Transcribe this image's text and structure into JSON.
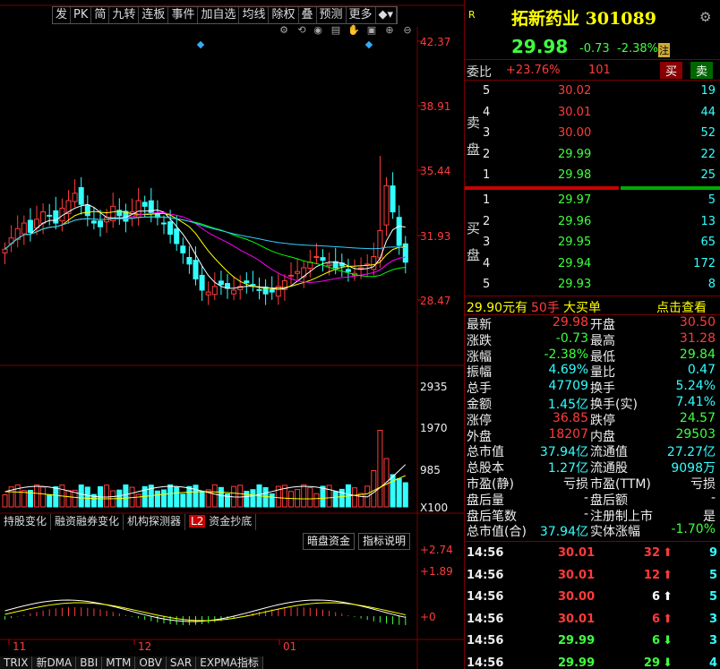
{
  "toolbar": {
    "buttons": [
      "发",
      "PK",
      "简",
      "九转",
      "连板",
      "事件",
      "加自选",
      "均线",
      "除权",
      "叠",
      "预测",
      "更多"
    ]
  },
  "price_axis": [
    "42.37",
    "38.91",
    "35.44",
    "31.93",
    "28.47"
  ],
  "volume_axis": [
    "2935",
    "1970",
    "985",
    "X100"
  ],
  "indicator_axis": [
    "+2.74",
    "+1.89",
    "+0"
  ],
  "date_axis": [
    "11",
    "12",
    "01"
  ],
  "mid_tabs": [
    "持股变化",
    "融资融券变化",
    "机构探测器",
    "资金抄底"
  ],
  "mid_tab_badge": "L2",
  "mid_buttons": [
    "暗盘资金",
    "指标说明"
  ],
  "bottom_tabs": [
    "TRIX",
    "新DMA",
    "BBI",
    "MTM",
    "OBV",
    "SAR",
    "EXPMA指标"
  ],
  "stock": {
    "r_badge": "R",
    "name": "拓新药业",
    "code": "301089",
    "price": "29.98",
    "change": "-0.73",
    "change_pct": "-2.38%",
    "tag": "注"
  },
  "webi": {
    "label": "委比",
    "value": "+23.76%",
    "diff": "101",
    "buy": "买",
    "sell": "卖"
  },
  "sell_label": [
    "卖",
    "盘"
  ],
  "buy_label": [
    "买",
    "盘"
  ],
  "sell_orders": [
    {
      "n": "5",
      "price": "30.02",
      "vol": "19"
    },
    {
      "n": "4",
      "price": "30.01",
      "vol": "44"
    },
    {
      "n": "3",
      "price": "30.00",
      "vol": "52"
    },
    {
      "n": "2",
      "price": "29.99",
      "vol": "22"
    },
    {
      "n": "1",
      "price": "29.98",
      "vol": "25"
    }
  ],
  "buy_orders": [
    {
      "n": "1",
      "price": "29.97",
      "vol": "5"
    },
    {
      "n": "2",
      "price": "29.96",
      "vol": "13"
    },
    {
      "n": "3",
      "price": "29.95",
      "vol": "65"
    },
    {
      "n": "4",
      "price": "29.94",
      "vol": "172"
    },
    {
      "n": "5",
      "price": "29.93",
      "vol": "8"
    }
  ],
  "big_order": {
    "price": "29.90元有",
    "count": "50手",
    "label": "大买单",
    "link": "点击查看"
  },
  "stats": [
    {
      "l1": "最新",
      "v1": "29.98",
      "c1": "red",
      "l2": "开盘",
      "v2": "30.50",
      "c2": "red"
    },
    {
      "l1": "涨跌",
      "v1": "-0.73",
      "c1": "grn",
      "l2": "最高",
      "v2": "31.28",
      "c2": "red"
    },
    {
      "l1": "涨幅",
      "v1": "-2.38%",
      "c1": "grn",
      "l2": "最低",
      "v2": "29.84",
      "c2": "grn"
    },
    {
      "l1": "振幅",
      "v1": "4.69%",
      "c1": "cyan",
      "l2": "量比",
      "v2": "0.47",
      "c2": "cyan"
    },
    {
      "l1": "总手",
      "v1": "47709",
      "c1": "cyan",
      "l2": "换手",
      "v2": "5.24%",
      "c2": "cyan"
    },
    {
      "l1": "金额",
      "v1": "1.45亿",
      "c1": "cyan",
      "l2": "换手(实)",
      "v2": "7.41%",
      "c2": "cyan"
    },
    {
      "l1": "涨停",
      "v1": "36.85",
      "c1": "red",
      "l2": "跌停",
      "v2": "24.57",
      "c2": "grn"
    },
    {
      "l1": "外盘",
      "v1": "18207",
      "c1": "red",
      "l2": "内盘",
      "v2": "29503",
      "c2": "grn"
    },
    {
      "l1": "总市值",
      "v1": "37.94亿",
      "c1": "cyan",
      "l2": "流通值",
      "v2": "27.27亿",
      "c2": "cyan"
    },
    {
      "l1": "总股本",
      "v1": "1.27亿",
      "c1": "cyan",
      "l2": "流通股",
      "v2": "9098万",
      "c2": "cyan"
    },
    {
      "l1": "市盈(静)",
      "v1": "亏损",
      "c1": "wht",
      "l2": "市盈(TTM)",
      "v2": "亏损",
      "c2": "wht"
    },
    {
      "l1": "盘后量",
      "v1": "-",
      "c1": "wht",
      "l2": "盘后额",
      "v2": "-",
      "c2": "wht"
    },
    {
      "l1": "盘后笔数",
      "v1": "-",
      "c1": "wht",
      "l2": "注册制上市",
      "v2": "是",
      "c2": "wht"
    },
    {
      "l1": "总市值(合)",
      "v1": "37.94亿",
      "c1": "cyan",
      "l2": "实体涨幅",
      "v2": "-1.70%",
      "c2": "grn"
    }
  ],
  "ticks": [
    {
      "time": "14:56",
      "price": "30.01",
      "vol": "32",
      "dir": "up",
      "n": "9"
    },
    {
      "time": "14:56",
      "price": "30.01",
      "vol": "12",
      "dir": "up",
      "n": "5"
    },
    {
      "time": "14:56",
      "price": "30.00",
      "vol": "6",
      "dir": "up-w",
      "n": "5"
    },
    {
      "time": "14:56",
      "price": "30.01",
      "vol": "6",
      "dir": "up",
      "n": "3"
    },
    {
      "time": "14:56",
      "price": "29.99",
      "vol": "6",
      "dir": "down",
      "n": "3"
    },
    {
      "time": "14:56",
      "price": "29.99",
      "vol": "29",
      "dir": "down",
      "n": "4"
    }
  ],
  "colors": {
    "up": "#ff3b3b",
    "down": "#3ff",
    "ma5": "#fff",
    "ma10": "#ff0",
    "ma20": "#f0f",
    "ma30": "#0f0",
    "ma60": "#3cf"
  }
}
